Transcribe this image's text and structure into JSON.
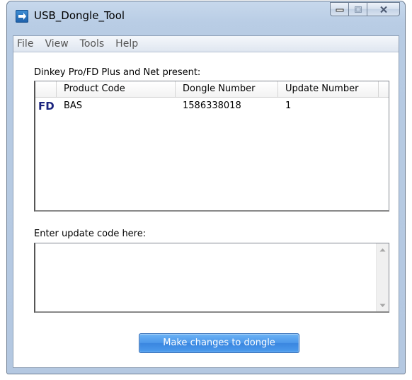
{
  "window": {
    "title": "USB_Dongle_Tool"
  },
  "menubar": {
    "items": [
      "File",
      "View",
      "Tools",
      "Help"
    ]
  },
  "dongles": {
    "label": "Dinkey Pro/FD Plus and Net present:",
    "columns": [
      "Product Code",
      "Dongle Number",
      "Update Number"
    ],
    "rows": [
      {
        "icon_text": "FD",
        "product_code": "BAS",
        "dongle_number": "1586338018",
        "update_number": "1"
      }
    ]
  },
  "update": {
    "label": "Enter update code here:",
    "value": ""
  },
  "actions": {
    "apply_label": "Make changes to dongle"
  },
  "colors": {
    "accent": "#4a96ea",
    "fd_icon": "#1a237e"
  }
}
